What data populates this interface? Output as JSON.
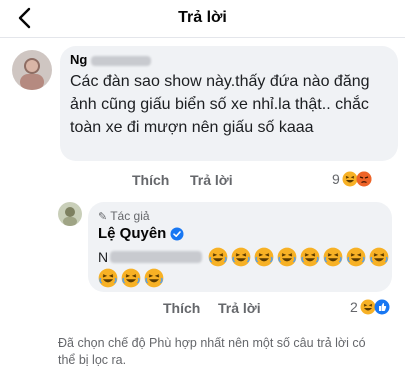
{
  "header": {
    "title": "Trả lời",
    "back_icon": "chevron-left-icon"
  },
  "comment1": {
    "author_partial": "Ng",
    "text": "Các đàn sao show  này.thấy đứa nào đăng ảnh cũng giấu biển số xe nhỉ.la thật.. chắc toàn xe đi mượn nên giấu số kaaa",
    "like_label": "Thích",
    "reply_label": "Trả lời",
    "reaction_count": "9",
    "reaction_icons": [
      "haha-icon",
      "angry-icon"
    ]
  },
  "comment2": {
    "author_tag": "Tác giả",
    "author_name": "Lệ Quyên",
    "verified": true,
    "mention_partial": "N",
    "emoji_line1_count": 8,
    "emoji_line2_count": 3,
    "like_label": "Thích",
    "reply_label": "Trả lời",
    "reaction_count": "2",
    "reaction_icons": [
      "haha-icon",
      "like-icon"
    ]
  },
  "footer": {
    "note": "Đã chọn chế độ Phù hợp nhất nên một số câu trả lời có thể bị lọc ra."
  },
  "colors": {
    "link_blue": "#1877f2",
    "secondary_text": "#65676b",
    "bubble_bg": "#f0f2f5",
    "haha_yellow": "#f7b125"
  }
}
